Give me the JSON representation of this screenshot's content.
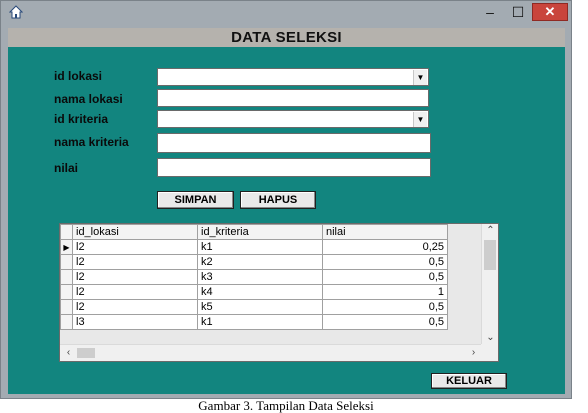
{
  "window": {
    "icon": "home-icon",
    "controls": {
      "minimize": "–",
      "maximize": "☐",
      "close": "✕"
    }
  },
  "header": {
    "title": "DATA SELEKSI"
  },
  "form": {
    "id_lokasi_label": "id lokasi",
    "nama_lokasi_label": "nama lokasi",
    "id_kriteria_label": "id kriteria",
    "nama_kriteria_label": "nama kriteria",
    "nilai_label": "nilai",
    "id_lokasi_value": "",
    "nama_lokasi_value": "",
    "id_kriteria_value": "",
    "nama_kriteria_value": "",
    "nilai_value": ""
  },
  "buttons": {
    "simpan": "SIMPAN",
    "hapus": "HAPUS",
    "keluar": "KELUAR"
  },
  "grid": {
    "columns": [
      "id_lokasi",
      "id_kriteria",
      "nilai"
    ],
    "rows": [
      {
        "id_lokasi": "l2",
        "id_kriteria": "k1",
        "nilai": "0,25"
      },
      {
        "id_lokasi": "l2",
        "id_kriteria": "k2",
        "nilai": "0,5"
      },
      {
        "id_lokasi": "l2",
        "id_kriteria": "k3",
        "nilai": "0,5"
      },
      {
        "id_lokasi": "l2",
        "id_kriteria": "k4",
        "nilai": "1"
      },
      {
        "id_lokasi": "l2",
        "id_kriteria": "k5",
        "nilai": "0,5"
      },
      {
        "id_lokasi": "l3",
        "id_kriteria": "k1",
        "nilai": "0,5"
      }
    ],
    "current_row_marker": "▶"
  },
  "caption": "Gambar 3. Tampilan Data Seleksi",
  "colors": {
    "background": "#12857f",
    "header_band": "#b5b2ad",
    "chrome": "#a3abb2",
    "close": "#c9453c"
  }
}
